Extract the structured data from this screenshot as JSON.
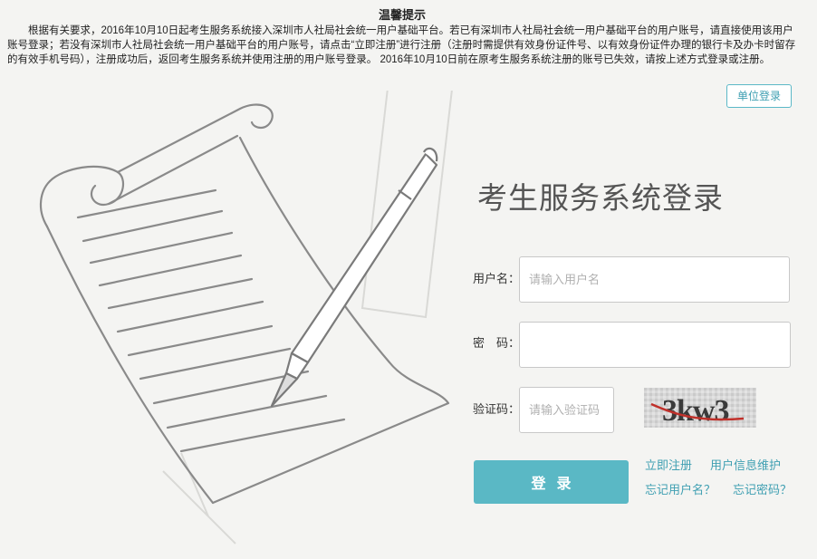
{
  "notice": {
    "title": "温馨提示",
    "body": "根据有关要求，2016年10月10日起考生服务系统接入深圳市人社局社会统一用户基础平台。若已有深圳市人社局社会统一用户基础平台的用户账号，请直接使用该用户账号登录；若没有深圳市人社局社会统一用户基础平台的用户账号，请点击“立即注册”进行注册（注册时需提供有效身份证件号、以有效身份证件办理的银行卡及办卡时留存的有效手机号码），注册成功后，返回考生服务系统并使用注册的用户账号登录。 2016年10月10日前在原考生服务系统注册的账号已失效，请按上述方式登录或注册。"
  },
  "unit_login": "单位登录",
  "login": {
    "title": "考生服务系统登录",
    "username_label": "用户名：",
    "username_placeholder": "请输入用户名",
    "username_value": "",
    "password_label": "密　码：",
    "password_value": "",
    "captcha_label": "验证码：",
    "captcha_placeholder": "请输入验证码",
    "captcha_value": "",
    "captcha_text": "3kw3",
    "submit": "登录"
  },
  "links": {
    "register": "立即注册",
    "user_info": "用户信息维护",
    "forgot_username": "忘记用户名？",
    "forgot_password": "忘记密码？"
  },
  "icons": [
    "paper-scroll-illustration",
    "pen-icon"
  ],
  "colors": {
    "accent": "#5ab8c5",
    "link": "#3f9fb2",
    "background": "#f4f4f2"
  }
}
